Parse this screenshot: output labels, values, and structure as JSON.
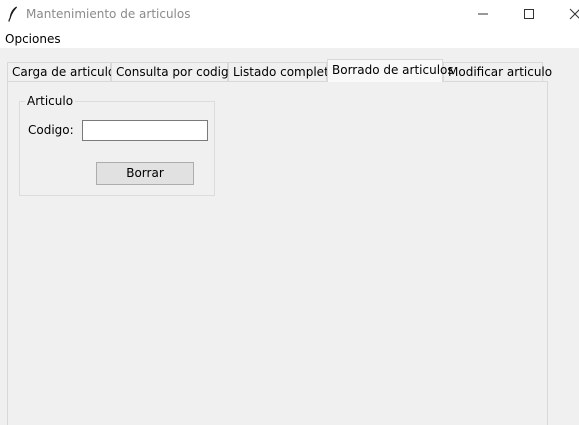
{
  "window": {
    "title": "Mantenimiento de articulos",
    "icon": "feather-icon",
    "controls": {
      "minimize_icon": "minimize-icon",
      "maximize_icon": "maximize-icon",
      "close_icon": "close-icon"
    }
  },
  "menubar": {
    "items": [
      {
        "label": "Opciones"
      }
    ]
  },
  "tabs": [
    {
      "label": "Carga de articulos",
      "selected": false
    },
    {
      "label": "Consulta por codigo",
      "selected": false
    },
    {
      "label": "Listado completo",
      "selected": false
    },
    {
      "label": "Borrado de articulos",
      "selected": true
    },
    {
      "label": "Modificar articulo",
      "selected": false
    }
  ],
  "form": {
    "frame_title": "Articulo",
    "codigo_label": "Codigo:",
    "codigo_value": "",
    "codigo_placeholder": "",
    "borrar_label": "Borrar"
  },
  "colors": {
    "background": "#f0f0f0",
    "title_text": "#8a8a8a",
    "tab_border": "#d9d9d9",
    "button_face": "#e1e1e1"
  }
}
